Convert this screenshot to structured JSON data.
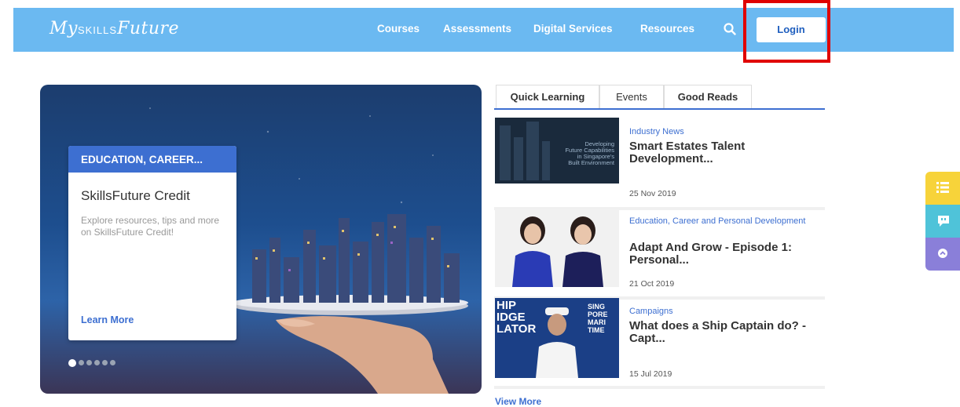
{
  "header": {
    "logo_prefix": "My",
    "logo_middle": "SKILLS",
    "logo_suffix": "Future",
    "nav": [
      "Courses",
      "Assessments",
      "Digital Services",
      "Resources"
    ],
    "login_label": "Login",
    "colors": {
      "bar": "#6bb9f1",
      "accent": "#3d6fd1",
      "highlight": "#e00000"
    }
  },
  "hero": {
    "card_category": "EDUCATION, CAREER...",
    "card_title": "SkillsFuture Credit",
    "card_description": "Explore resources, tips and more on SkillsFuture Credit!",
    "card_link": "Learn More",
    "slide_count": 6,
    "active_slide": 1
  },
  "tabs": [
    "Quick Learning",
    "Events",
    "Good Reads"
  ],
  "active_tab": "Quick Learning",
  "articles": [
    {
      "category": "Industry News",
      "title": "Smart Estates Talent Development...",
      "date": "25 Nov 2019",
      "thumb_text": [
        "Developing",
        "Future Capabilities",
        "in Singapore's",
        "Built Environment"
      ]
    },
    {
      "category": "Education, Career and Personal Development",
      "title": "Adapt And Grow - Episode 1: Personal...",
      "date": "21 Oct 2019"
    },
    {
      "category": "Campaigns",
      "title": "What does a Ship Captain do? - Capt...",
      "date": "15 Jul 2019",
      "thumb_text": [
        "HIP",
        "IDGE",
        "LATOR",
        "SING",
        "PORE",
        "MARI",
        "TIME"
      ]
    }
  ],
  "view_more": "View More",
  "side_buttons": [
    {
      "icon": "list-icon",
      "color": "#f7d33a"
    },
    {
      "icon": "chat-icon",
      "color": "#4fc3d9"
    },
    {
      "icon": "scroll-up-icon",
      "color": "#8a7fd9"
    }
  ]
}
